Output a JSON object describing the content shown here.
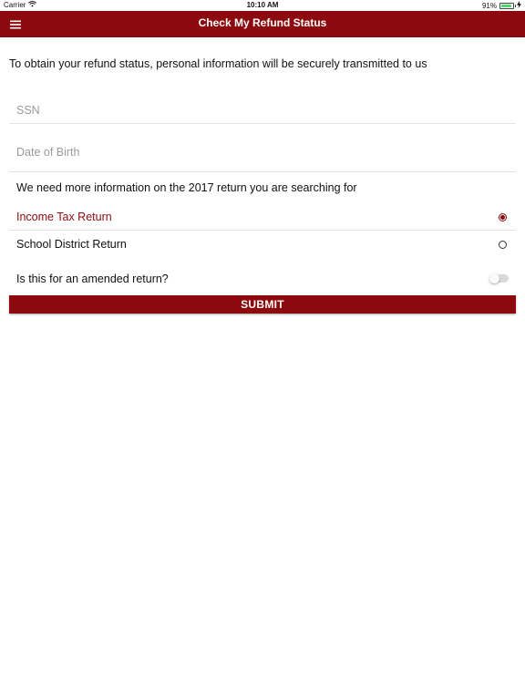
{
  "status_bar": {
    "carrier": "Carrier",
    "time": "10:10 AM",
    "battery_text": "91%",
    "battery_level": 0.91,
    "wifi_icon": "wifi-icon",
    "charging_icon": "bolt-icon"
  },
  "nav": {
    "title": "Check My Refund Status",
    "menu_icon": "hamburger-menu-icon",
    "background_color": "#8c0a0e"
  },
  "form": {
    "intro": "To obtain your refund status, personal information will be securely transmitted to us",
    "ssn": {
      "placeholder": "SSN",
      "value": ""
    },
    "dob": {
      "placeholder": "Date of Birth",
      "value": ""
    },
    "info": "We need more information on the 2017 return you are searching for",
    "return_types": [
      {
        "label": "Income Tax Return",
        "selected": true
      },
      {
        "label": "School District Return",
        "selected": false
      }
    ],
    "amended": {
      "label": "Is this for an amended return?",
      "enabled": false
    },
    "submit_label": "SUBMIT"
  },
  "colors": {
    "accent": "#8c0a0e",
    "divider": "#e3e3e3",
    "placeholder": "#9a9a9a"
  }
}
